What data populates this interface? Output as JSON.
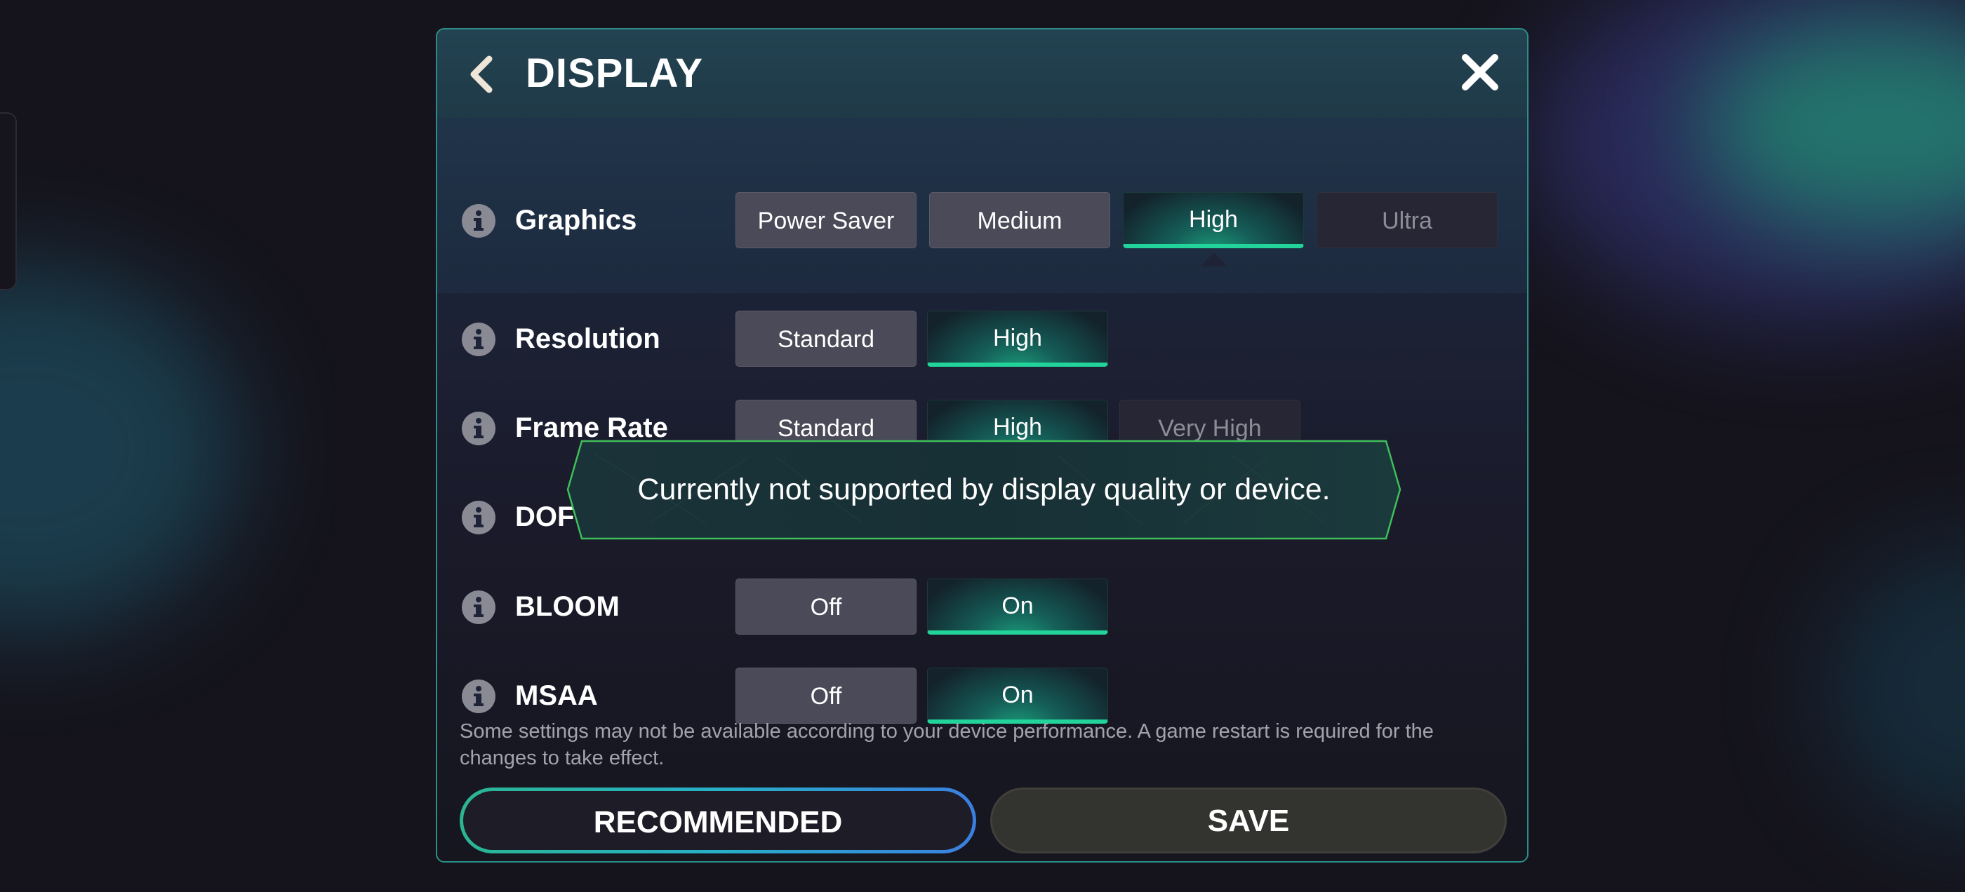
{
  "panel": {
    "title": "DISPLAY",
    "back_icon": "chevron-left-icon",
    "close_icon": "close-icon"
  },
  "settings": [
    {
      "label": "Graphics",
      "options": [
        {
          "label": "Power Saver",
          "state": "normal"
        },
        {
          "label": "Medium",
          "state": "normal"
        },
        {
          "label": "High",
          "state": "selected"
        },
        {
          "label": "Ultra",
          "state": "disabled"
        }
      ]
    },
    {
      "label": "Resolution",
      "options": [
        {
          "label": "Standard",
          "state": "normal"
        },
        {
          "label": "High",
          "state": "selected"
        }
      ]
    },
    {
      "label": "Frame Rate",
      "options": [
        {
          "label": "Standard",
          "state": "normal"
        },
        {
          "label": "High",
          "state": "selected"
        },
        {
          "label": "Very High",
          "state": "disabled"
        }
      ]
    },
    {
      "label": "DOF"
    },
    {
      "label": "BLOOM",
      "options": [
        {
          "label": "Off",
          "state": "normal"
        },
        {
          "label": "On",
          "state": "selected"
        }
      ]
    },
    {
      "label": "MSAA",
      "options": [
        {
          "label": "Off",
          "state": "normal"
        },
        {
          "label": "On",
          "state": "selected"
        }
      ]
    }
  ],
  "tooltip": {
    "text": "Currently not supported by display quality or device."
  },
  "note": "Some settings may not be available according to your device performance. A game restart is required for the changes to take effect.",
  "buttons": {
    "recommended": "RECOMMENDED",
    "save": "SAVE"
  },
  "colors": {
    "accent_green": "#22d49a",
    "accent_teal": "#2b8f88",
    "accent_blue": "#3b7fe0",
    "tooltip_border": "#3fbf5a"
  }
}
